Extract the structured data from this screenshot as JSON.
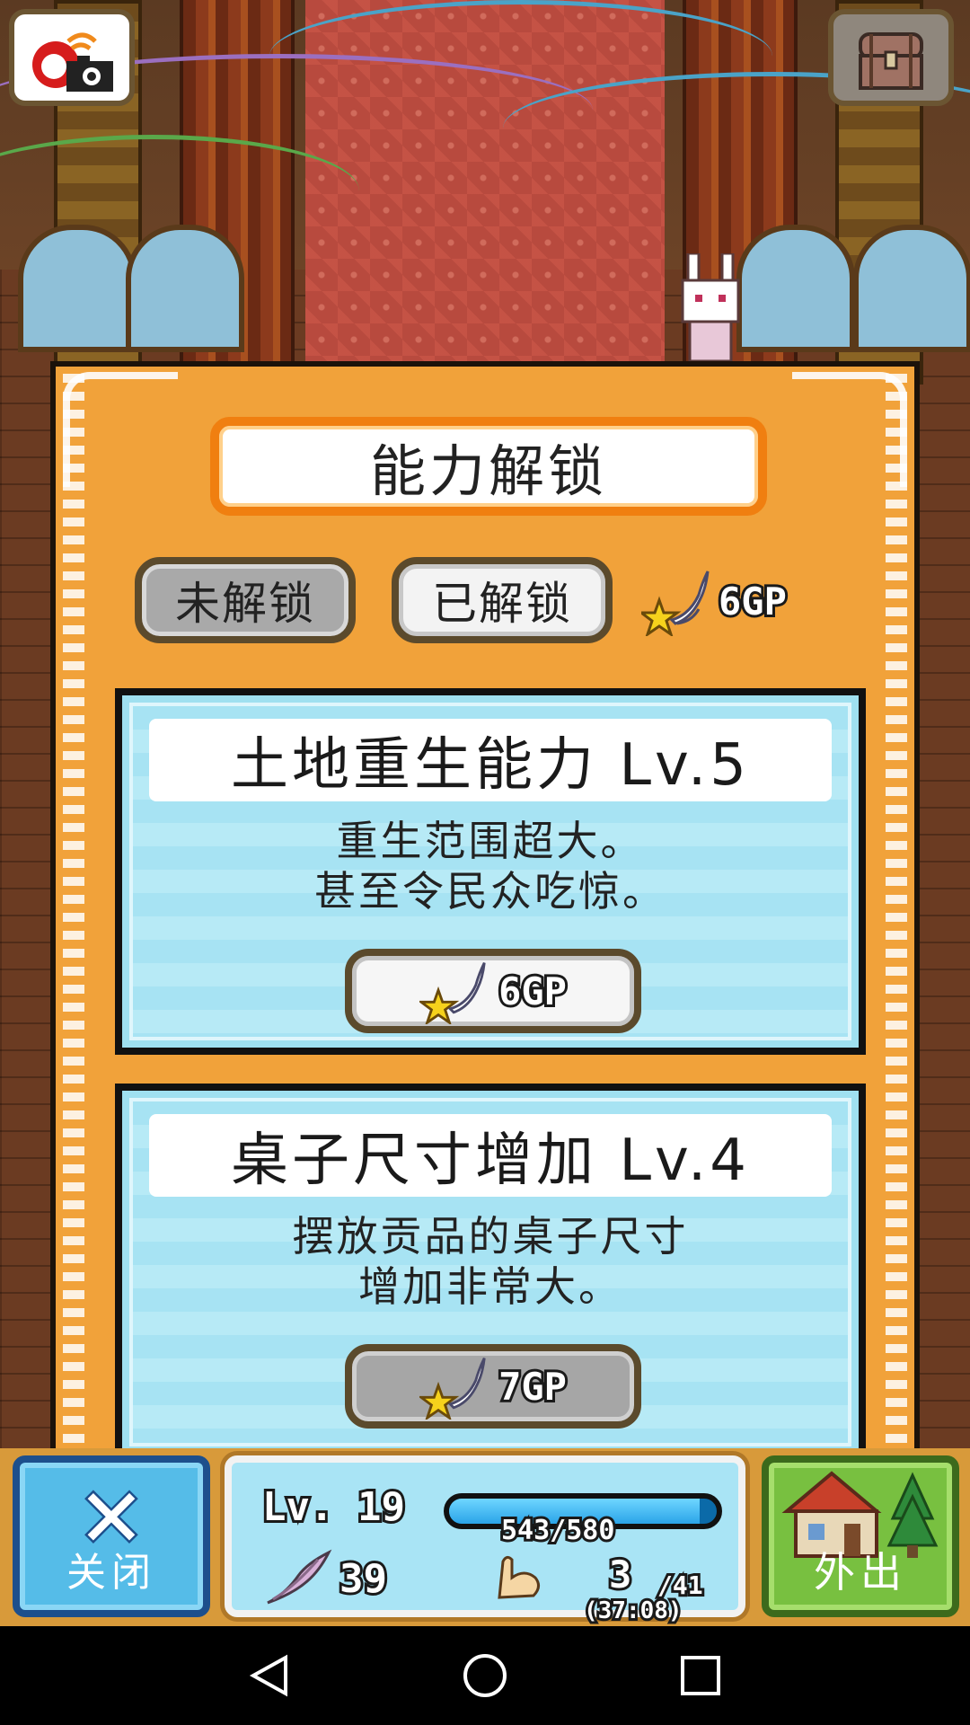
{
  "top_bar": {
    "camera_icon": "camera-icon",
    "chest_icon": "treasure-chest-icon"
  },
  "panel": {
    "title": "能力解锁",
    "tabs": [
      {
        "label": "未解锁",
        "state": "selected"
      },
      {
        "label": "已解锁",
        "state": "normal"
      }
    ],
    "gp_balance": "6GP",
    "gp_icon": "star-wing-icon"
  },
  "abilities": [
    {
      "title": "土地重生能力 Lv.5",
      "description_line1": "重生范围超大。",
      "description_line2": "甚至令民众吃惊。",
      "cost": "6GP",
      "enabled": true
    },
    {
      "title": "桌子尺寸增加 Lv.4",
      "description_line1": "摆放贡品的桌子尺寸",
      "description_line2": "增加非常大。",
      "cost": "7GP",
      "enabled": false
    }
  ],
  "hud": {
    "close_label": "关闭",
    "close_glyph": "✕",
    "level": "Lv. 19",
    "exp_text": "543/580",
    "exp_fraction": 0.936,
    "feather_count": "39",
    "stamina_current": "3",
    "stamina_max": "/41",
    "stamina_timer": "(37:08)",
    "go_out_label": "外出"
  },
  "colors": {
    "panel_orange": "#f1a23a",
    "title_border": "#f07f10",
    "card_blue": "#a7e3f3",
    "close_blue": "#55bce8",
    "out_green": "#78c040"
  }
}
